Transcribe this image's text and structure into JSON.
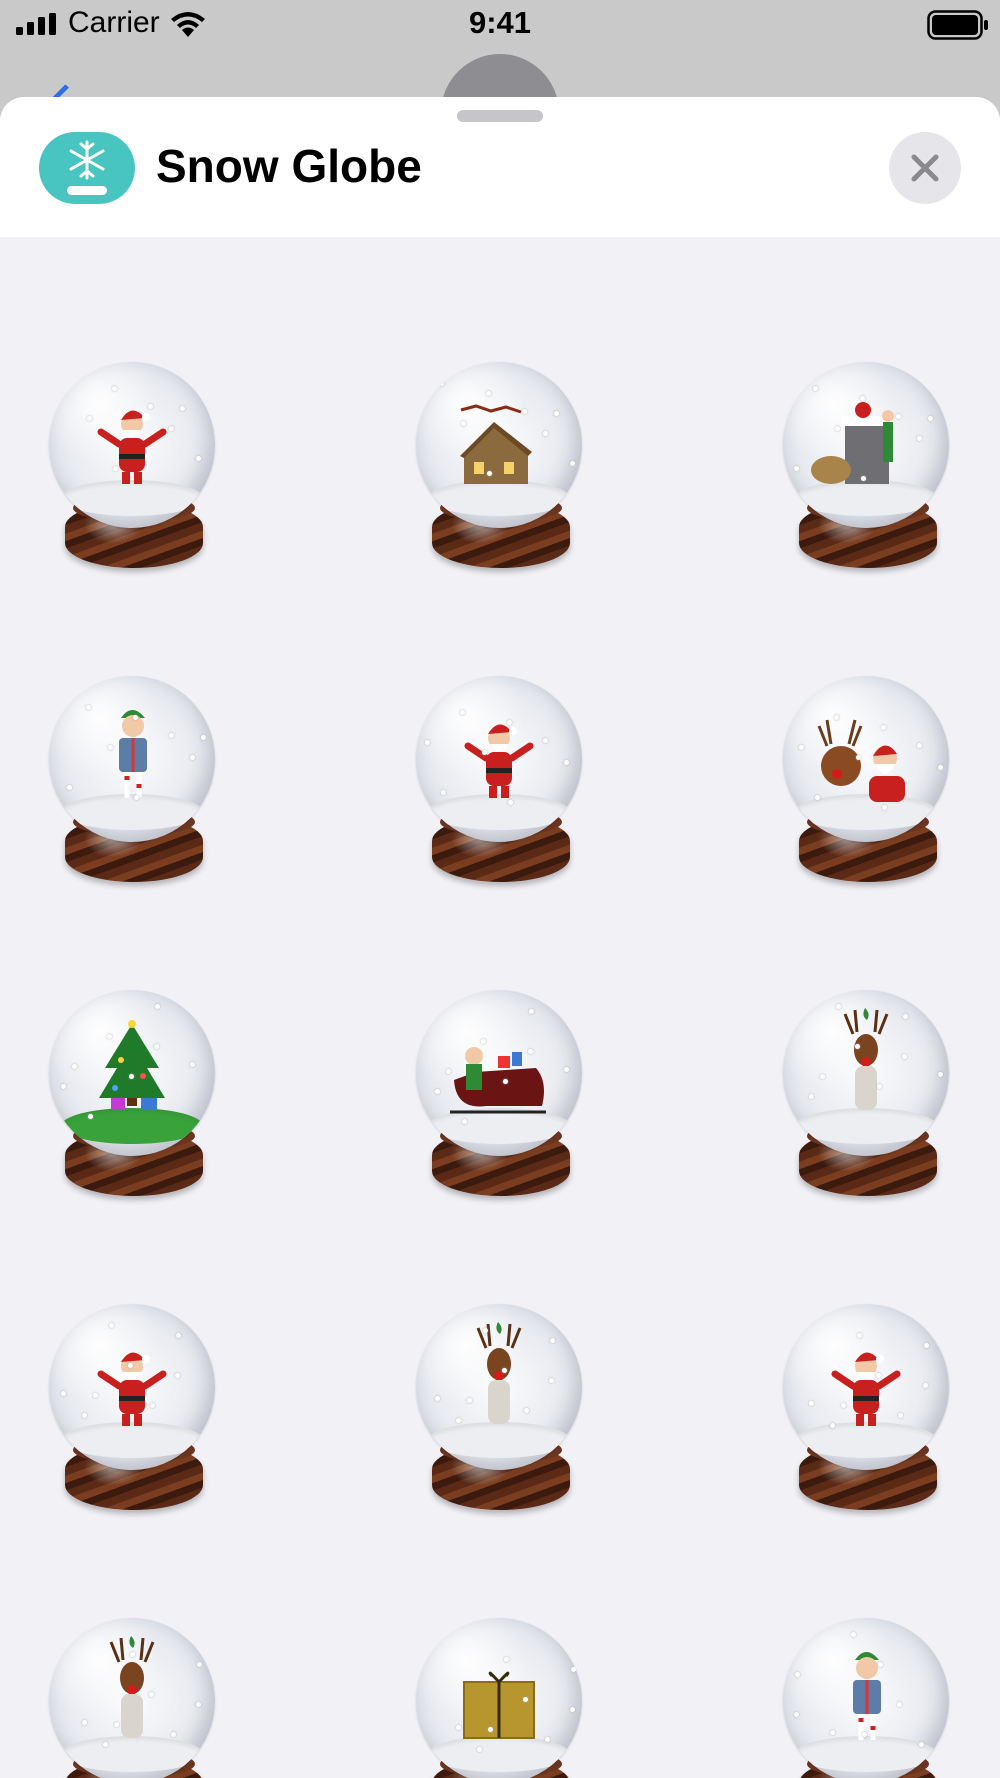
{
  "status_bar": {
    "carrier": "Carrier",
    "time": "9:41"
  },
  "sheet": {
    "title": "Snow Globe"
  },
  "stickers": [
    {
      "name": "santa-arms-open-globe",
      "figure": "santa"
    },
    {
      "name": "sleigh-over-house-globe",
      "figure": "house"
    },
    {
      "name": "santa-chimney-elf-globe",
      "figure": "chimney"
    },
    {
      "name": "elf-with-gift-globe",
      "figure": "elf"
    },
    {
      "name": "santa-with-sack-globe",
      "figure": "santa"
    },
    {
      "name": "reindeer-and-santa-globe",
      "figure": "reindeer-santa"
    },
    {
      "name": "christmas-tree-globe",
      "figure": "tree"
    },
    {
      "name": "elf-sleigh-globe",
      "figure": "sleigh"
    },
    {
      "name": "reindeer-mistletoe-globe",
      "figure": "reindeer"
    },
    {
      "name": "santa-merry-christmas-globe",
      "figure": "santa"
    },
    {
      "name": "reindeer-merry-christmas-globe",
      "figure": "reindeer"
    },
    {
      "name": "santa-happy-holidays-globe",
      "figure": "santa"
    },
    {
      "name": "reindeer-happy-holidays-globe",
      "figure": "reindeer"
    },
    {
      "name": "gift-thank-you-globe",
      "figure": "gift"
    },
    {
      "name": "elf-thank-you-globe",
      "figure": "elf"
    }
  ],
  "colors": {
    "sheet_background": "#f1f1f6",
    "header_background": "#ffffff",
    "app_icon": "#48c5c0",
    "close_button": "#e6e6ea",
    "santa_red": "#c8201e",
    "elf_green": "#2e8a34",
    "wood": "#6b3520"
  },
  "icons": {
    "app": "snowflake-globe-icon",
    "close": "close-icon"
  }
}
